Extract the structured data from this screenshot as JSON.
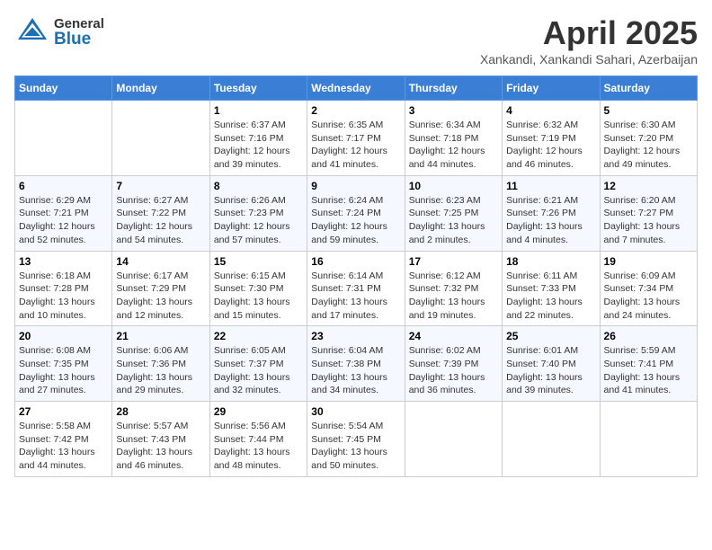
{
  "header": {
    "logo_general": "General",
    "logo_blue": "Blue",
    "title": "April 2025",
    "subtitle": "Xankandi, Xankandi Sahari, Azerbaijan"
  },
  "days_of_week": [
    "Sunday",
    "Monday",
    "Tuesday",
    "Wednesday",
    "Thursday",
    "Friday",
    "Saturday"
  ],
  "weeks": [
    [
      {
        "day": "",
        "info": ""
      },
      {
        "day": "",
        "info": ""
      },
      {
        "day": "1",
        "info": "Sunrise: 6:37 AM\nSunset: 7:16 PM\nDaylight: 12 hours and 39 minutes."
      },
      {
        "day": "2",
        "info": "Sunrise: 6:35 AM\nSunset: 7:17 PM\nDaylight: 12 hours and 41 minutes."
      },
      {
        "day": "3",
        "info": "Sunrise: 6:34 AM\nSunset: 7:18 PM\nDaylight: 12 hours and 44 minutes."
      },
      {
        "day": "4",
        "info": "Sunrise: 6:32 AM\nSunset: 7:19 PM\nDaylight: 12 hours and 46 minutes."
      },
      {
        "day": "5",
        "info": "Sunrise: 6:30 AM\nSunset: 7:20 PM\nDaylight: 12 hours and 49 minutes."
      }
    ],
    [
      {
        "day": "6",
        "info": "Sunrise: 6:29 AM\nSunset: 7:21 PM\nDaylight: 12 hours and 52 minutes."
      },
      {
        "day": "7",
        "info": "Sunrise: 6:27 AM\nSunset: 7:22 PM\nDaylight: 12 hours and 54 minutes."
      },
      {
        "day": "8",
        "info": "Sunrise: 6:26 AM\nSunset: 7:23 PM\nDaylight: 12 hours and 57 minutes."
      },
      {
        "day": "9",
        "info": "Sunrise: 6:24 AM\nSunset: 7:24 PM\nDaylight: 12 hours and 59 minutes."
      },
      {
        "day": "10",
        "info": "Sunrise: 6:23 AM\nSunset: 7:25 PM\nDaylight: 13 hours and 2 minutes."
      },
      {
        "day": "11",
        "info": "Sunrise: 6:21 AM\nSunset: 7:26 PM\nDaylight: 13 hours and 4 minutes."
      },
      {
        "day": "12",
        "info": "Sunrise: 6:20 AM\nSunset: 7:27 PM\nDaylight: 13 hours and 7 minutes."
      }
    ],
    [
      {
        "day": "13",
        "info": "Sunrise: 6:18 AM\nSunset: 7:28 PM\nDaylight: 13 hours and 10 minutes."
      },
      {
        "day": "14",
        "info": "Sunrise: 6:17 AM\nSunset: 7:29 PM\nDaylight: 13 hours and 12 minutes."
      },
      {
        "day": "15",
        "info": "Sunrise: 6:15 AM\nSunset: 7:30 PM\nDaylight: 13 hours and 15 minutes."
      },
      {
        "day": "16",
        "info": "Sunrise: 6:14 AM\nSunset: 7:31 PM\nDaylight: 13 hours and 17 minutes."
      },
      {
        "day": "17",
        "info": "Sunrise: 6:12 AM\nSunset: 7:32 PM\nDaylight: 13 hours and 19 minutes."
      },
      {
        "day": "18",
        "info": "Sunrise: 6:11 AM\nSunset: 7:33 PM\nDaylight: 13 hours and 22 minutes."
      },
      {
        "day": "19",
        "info": "Sunrise: 6:09 AM\nSunset: 7:34 PM\nDaylight: 13 hours and 24 minutes."
      }
    ],
    [
      {
        "day": "20",
        "info": "Sunrise: 6:08 AM\nSunset: 7:35 PM\nDaylight: 13 hours and 27 minutes."
      },
      {
        "day": "21",
        "info": "Sunrise: 6:06 AM\nSunset: 7:36 PM\nDaylight: 13 hours and 29 minutes."
      },
      {
        "day": "22",
        "info": "Sunrise: 6:05 AM\nSunset: 7:37 PM\nDaylight: 13 hours and 32 minutes."
      },
      {
        "day": "23",
        "info": "Sunrise: 6:04 AM\nSunset: 7:38 PM\nDaylight: 13 hours and 34 minutes."
      },
      {
        "day": "24",
        "info": "Sunrise: 6:02 AM\nSunset: 7:39 PM\nDaylight: 13 hours and 36 minutes."
      },
      {
        "day": "25",
        "info": "Sunrise: 6:01 AM\nSunset: 7:40 PM\nDaylight: 13 hours and 39 minutes."
      },
      {
        "day": "26",
        "info": "Sunrise: 5:59 AM\nSunset: 7:41 PM\nDaylight: 13 hours and 41 minutes."
      }
    ],
    [
      {
        "day": "27",
        "info": "Sunrise: 5:58 AM\nSunset: 7:42 PM\nDaylight: 13 hours and 44 minutes."
      },
      {
        "day": "28",
        "info": "Sunrise: 5:57 AM\nSunset: 7:43 PM\nDaylight: 13 hours and 46 minutes."
      },
      {
        "day": "29",
        "info": "Sunrise: 5:56 AM\nSunset: 7:44 PM\nDaylight: 13 hours and 48 minutes."
      },
      {
        "day": "30",
        "info": "Sunrise: 5:54 AM\nSunset: 7:45 PM\nDaylight: 13 hours and 50 minutes."
      },
      {
        "day": "",
        "info": ""
      },
      {
        "day": "",
        "info": ""
      },
      {
        "day": "",
        "info": ""
      }
    ]
  ]
}
